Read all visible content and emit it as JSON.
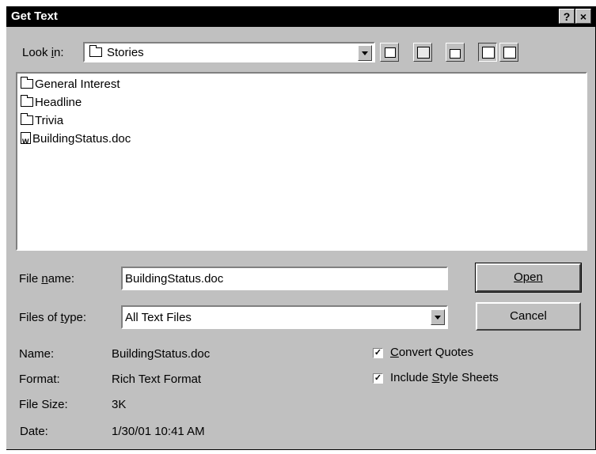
{
  "window": {
    "title": "Get Text",
    "help_glyph": "?",
    "close_glyph": "×"
  },
  "lookin": {
    "label": "Look in:",
    "value": "Stories"
  },
  "files": [
    {
      "name": "General Interest",
      "icon": "folder-icon"
    },
    {
      "name": "Headline",
      "icon": "folder-icon"
    },
    {
      "name": "Trivia",
      "icon": "folder-icon"
    },
    {
      "name": "BuildingStatus.doc",
      "icon": "word-document-icon"
    }
  ],
  "filename": {
    "label": "File name:",
    "value": "BuildingStatus.doc"
  },
  "filetype": {
    "label": "Files of type:",
    "value": "All Text Files"
  },
  "buttons": {
    "open": "Open",
    "cancel": "Cancel"
  },
  "info": [
    {
      "label": "Name:",
      "value": "BuildingStatus.doc"
    },
    {
      "label": "Format:",
      "value": "Rich Text Format"
    },
    {
      "label": "File Size:",
      "value": "3K"
    },
    {
      "label": "Date:",
      "value": "1/30/01 10:41 AM"
    }
  ],
  "options": [
    {
      "label": "Convert Quotes",
      "checked": true
    },
    {
      "label": "Include Style Sheets",
      "checked": true
    }
  ]
}
